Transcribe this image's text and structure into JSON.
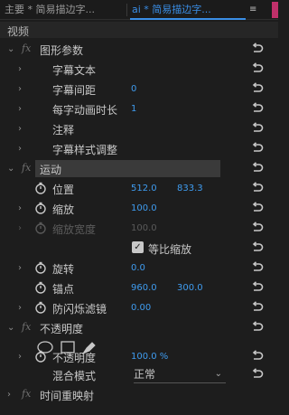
{
  "tabs": {
    "tab1": "主要 * 简易描边字...",
    "tab2_prefix": "ai *",
    "tab2_title": "简易描边字...",
    "menu_glyph": "≡"
  },
  "panel": {
    "section": "视频"
  },
  "effects": {
    "graphic": {
      "name": "图形参数",
      "params": {
        "subtitle_text": "字幕文本",
        "subtitle_spacing": {
          "label": "字幕间距",
          "value": "0"
        },
        "frame_time": {
          "label": "每字动画时长",
          "value": "1"
        },
        "comment": "注释",
        "style_adjust": "字幕样式调整"
      }
    },
    "motion": {
      "name": "运动",
      "position": {
        "label": "位置",
        "x": "512.0",
        "y": "833.3"
      },
      "scale": {
        "label": "缩放",
        "value": "100.0"
      },
      "scale_width": {
        "label": "缩放宽度",
        "value": "100.0"
      },
      "uniform_scale": {
        "label": "等比缩放",
        "checked": true
      },
      "rotation": {
        "label": "旋转",
        "value": "0.0"
      },
      "anchor": {
        "label": "锚点",
        "x": "960.0",
        "y": "300.0"
      },
      "anti_flicker": {
        "label": "防闪烁滤镜",
        "value": "0.00"
      }
    },
    "opacity": {
      "name": "不透明度",
      "tools": [
        "ellipse-mask",
        "rectangle-mask",
        "pen-mask"
      ],
      "opacity": {
        "label": "不透明度",
        "value": "100.0 %"
      },
      "blend_mode": {
        "label": "混合模式",
        "value": "正常"
      }
    },
    "time_remap": {
      "name": "时间重映射"
    }
  },
  "colors": {
    "value_blue": "#3f9cf0",
    "accent_pink": "#c0306a"
  }
}
